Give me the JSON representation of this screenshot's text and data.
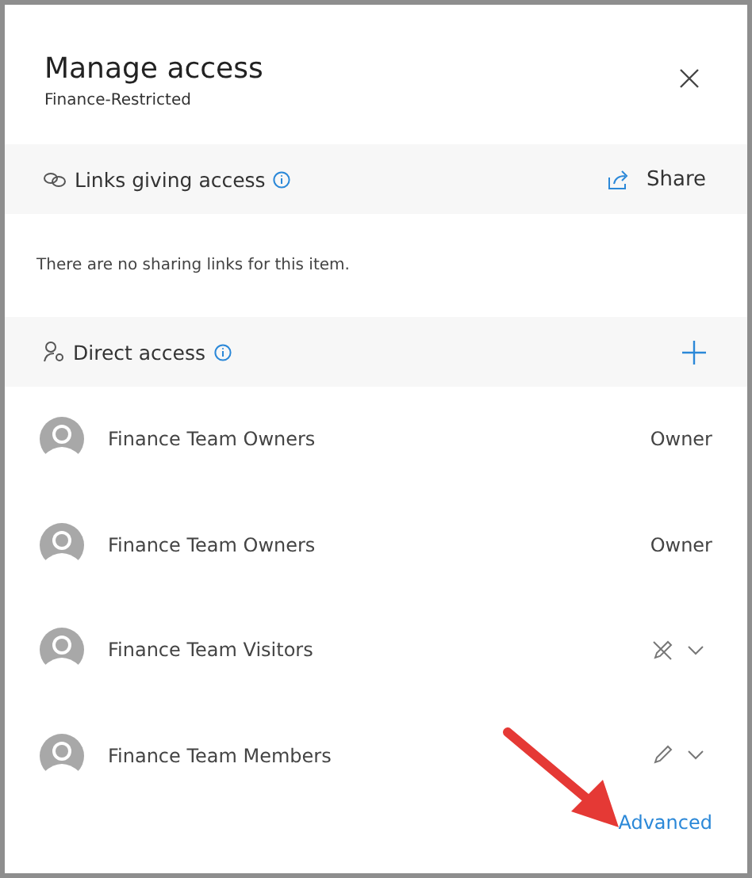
{
  "panel": {
    "title": "Manage access",
    "subtitle": "Finance-Restricted"
  },
  "links_section": {
    "label": "Links giving access",
    "action": "Share",
    "message": "There are no sharing links for this item."
  },
  "direct_section": {
    "label": "Direct access"
  },
  "people": [
    {
      "name": "Finance Team Owners",
      "kind": "owner",
      "role": "Owner"
    },
    {
      "name": "Finance Team Owners",
      "kind": "owner",
      "role": "Owner"
    },
    {
      "name": "Finance Team Visitors",
      "kind": "view"
    },
    {
      "name": "Finance Team Members",
      "kind": "edit"
    }
  ],
  "advanced_link": "Advanced"
}
